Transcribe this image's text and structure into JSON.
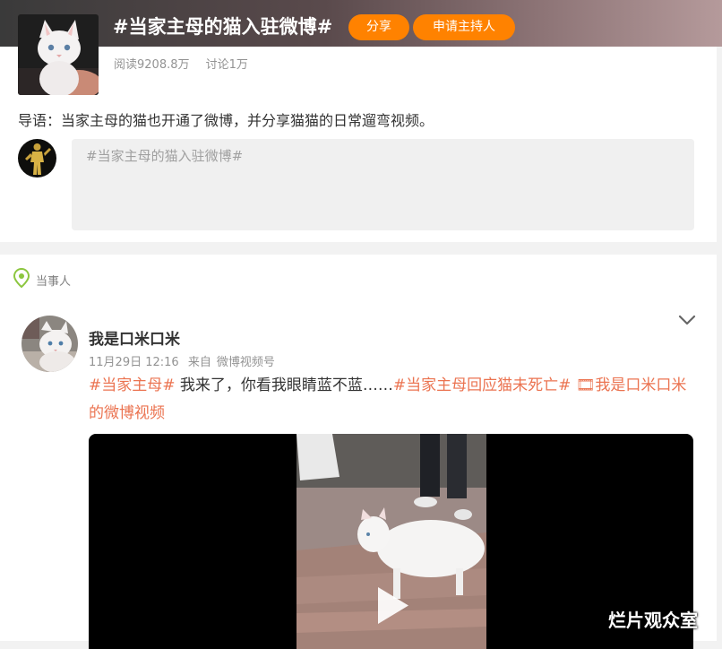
{
  "topic": {
    "title": "#当家主母的猫入驻微博#",
    "share_label": "分享",
    "host_label": "申请主持人",
    "reads": "阅读9208.8万",
    "discussions": "讨论1万",
    "intro": "导语：当家主母的猫也开通了微博，并分享猫猫的日常遛弯视频。",
    "compose_placeholder": "#当家主母的猫入驻微博#"
  },
  "section": {
    "label": "当事人"
  },
  "post": {
    "author": "我是口米口米",
    "date": "11月29日 12:16",
    "source_prefix": "来自",
    "source": "微博视频号",
    "tag1": "#当家主母#",
    "body": " 我来了，你看我眼睛蓝不蓝……",
    "tag2": "#当家主母回应猫未死亡#",
    "video_link": " 🎞我是口米口米的微博视频"
  },
  "watermark": "烂片观众室",
  "colors": {
    "accent": "#ff8200",
    "tag": "#eb7350",
    "header_dark": "#3a3a3a",
    "header_light": "#b59a9b"
  }
}
